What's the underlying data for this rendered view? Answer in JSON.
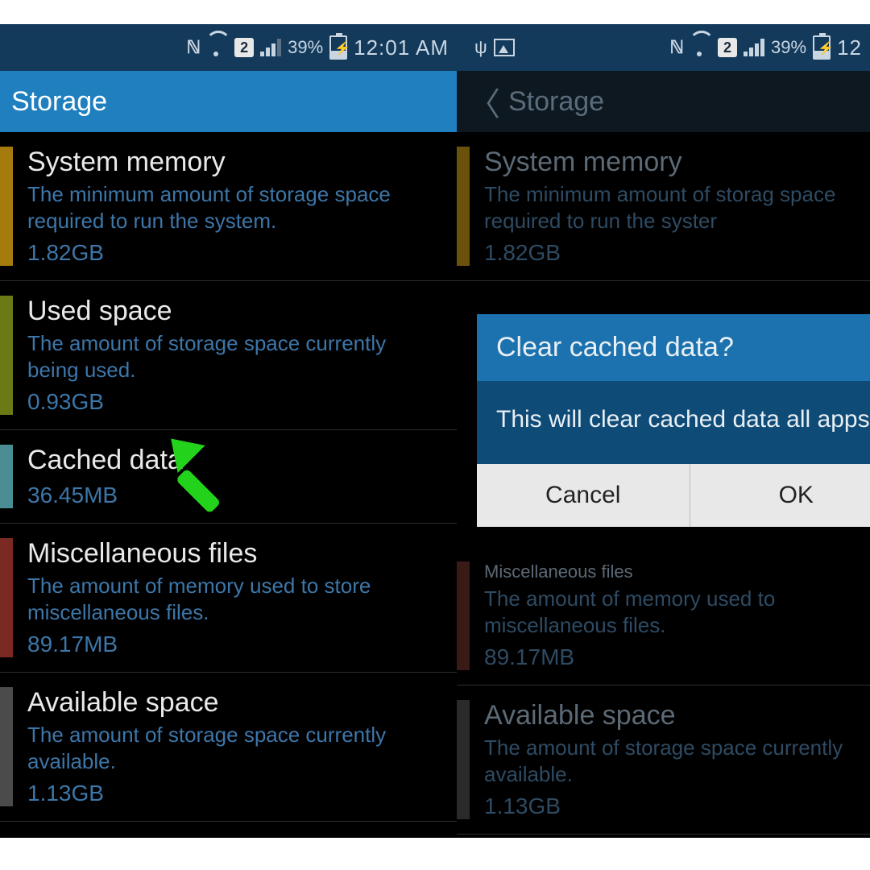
{
  "status": {
    "battery_pct": "39%",
    "time_left": "12:01 AM",
    "time_right": "12",
    "sim": "2"
  },
  "left": {
    "title": "Storage",
    "rows": [
      {
        "swatch": "#a57b0e",
        "title": "System memory",
        "desc": "The minimum amount of storage space required to run the system.",
        "size": "1.82GB"
      },
      {
        "swatch": "#6b7a14",
        "title": "Used space",
        "desc": "The amount of storage space currently being used.",
        "size": "0.93GB"
      },
      {
        "swatch": "#4a8d93",
        "title": "Cached data",
        "desc": "",
        "size": "36.45MB"
      },
      {
        "swatch": "#7a2a23",
        "title": "Miscellaneous files",
        "desc": "The amount of memory used to store miscellaneous files.",
        "size": "89.17MB"
      },
      {
        "swatch": "#4b4b4b",
        "title": "Available space",
        "desc": "The amount of storage space currently available.",
        "size": "1.13GB"
      }
    ]
  },
  "right": {
    "title": "Storage",
    "rows": [
      {
        "swatch": "#6a520c",
        "title": "System memory",
        "desc": "The minimum amount of storag space required to run the syster",
        "size": "1.82GB"
      },
      {
        "swatch": "#3a1a16",
        "title": "Miscellaneous files",
        "desc": "The amount of memory used to miscellaneous files.",
        "size": "89.17MB"
      },
      {
        "swatch": "#2a2a2a",
        "title": "Available space",
        "desc": "The amount of storage space currently available.",
        "size": "1.13GB"
      }
    ],
    "dialog": {
      "title": "Clear cached data?",
      "message": "This will clear cached data all apps.",
      "cancel": "Cancel",
      "ok": "OK"
    }
  }
}
